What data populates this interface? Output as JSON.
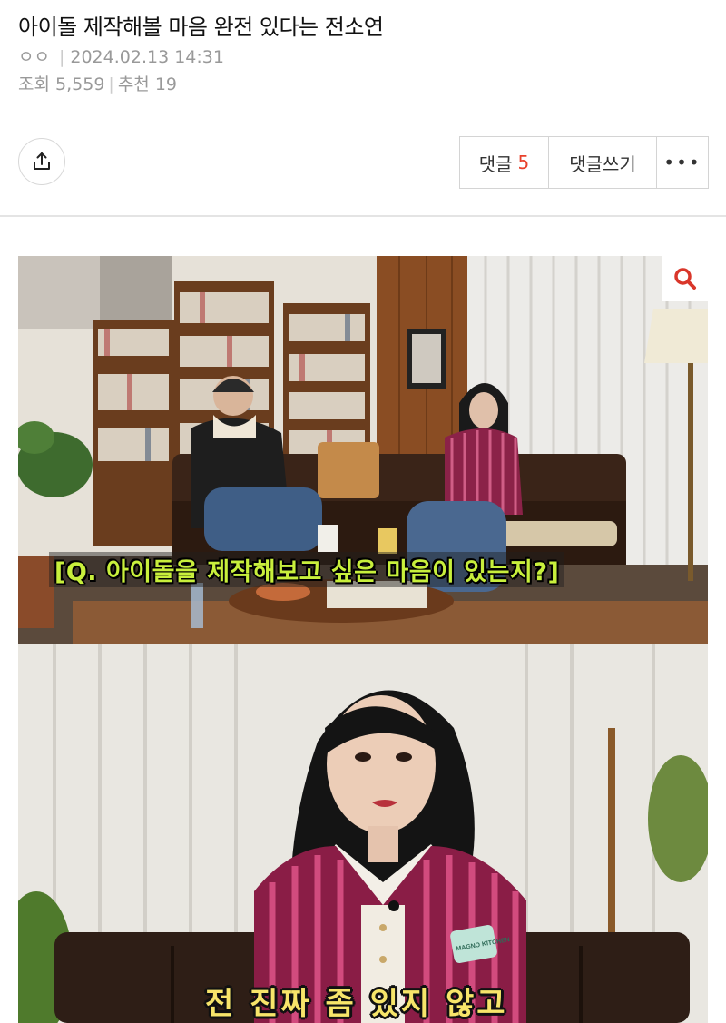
{
  "post": {
    "title": "아이돌 제작해볼 마음 완전 있다는 전소연",
    "author": "ㅇㅇ",
    "datetime": "2024.02.13 14:31",
    "views_label": "조회",
    "views": "5,559",
    "recommend_label": "추천",
    "recommend": "19"
  },
  "toolbar": {
    "share_icon": "share-icon",
    "comments_label": "댓글",
    "comments_count": "5",
    "write_comment_label": "댓글쓰기",
    "more_label": "•••"
  },
  "media": {
    "zoom_icon": "magnifier-icon",
    "caption_top": "[Q. 아이돌을 제작해보고 싶은 마음이 있는지?]",
    "caption_bottom": "전 진짜 좀 있지 않고",
    "badge_text": "MAGNO KITCHEN"
  },
  "colors": {
    "accent_red": "#e8412c",
    "caption_green": "#c8ef3c",
    "caption_yellow": "#f7e56a",
    "zoom_icon_red": "#d9362a"
  }
}
